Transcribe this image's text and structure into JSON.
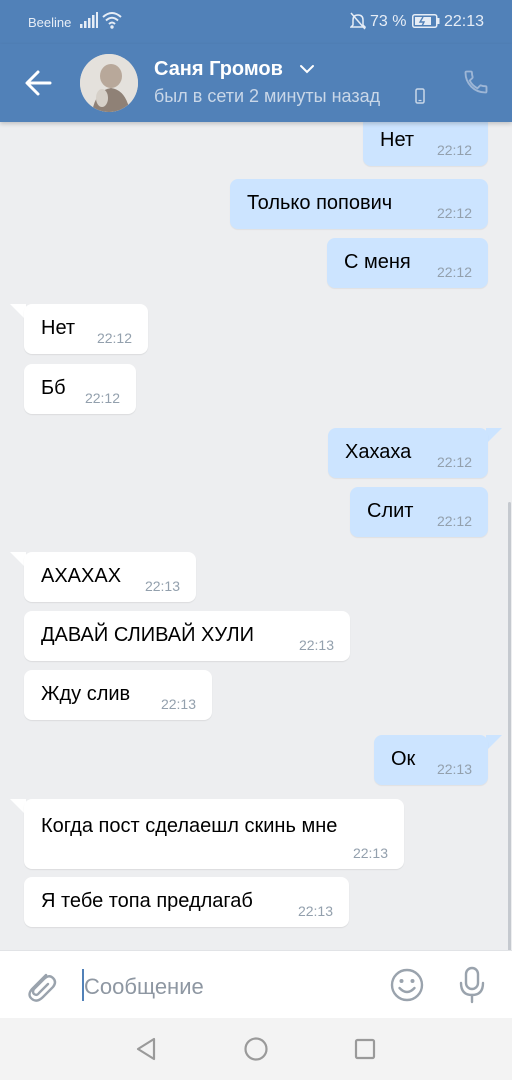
{
  "status_bar": {
    "carrier": "Beeline",
    "battery": "73 %",
    "time": "22:13"
  },
  "header": {
    "contact_name": "Саня Громов",
    "presence": "был в сети 2 минуты назад"
  },
  "messages": [
    {
      "dir": "out",
      "text": "Нет",
      "time": "22:12"
    },
    {
      "dir": "out",
      "text": "Только попович",
      "time": "22:12"
    },
    {
      "dir": "out",
      "text": "С меня",
      "time": "22:12"
    },
    {
      "dir": "in",
      "text": "Нет",
      "time": "22:12"
    },
    {
      "dir": "in",
      "text": "Бб",
      "time": "22:12"
    },
    {
      "dir": "out",
      "text": "Хахаха",
      "time": "22:12"
    },
    {
      "dir": "out",
      "text": "Слит",
      "time": "22:12"
    },
    {
      "dir": "in",
      "text": "АХАХАХ",
      "time": "22:13"
    },
    {
      "dir": "in",
      "text": "ДАВАЙ СЛИВАЙ ХУЛИ",
      "time": "22:13"
    },
    {
      "dir": "in",
      "text": "Жду слив",
      "time": "22:13"
    },
    {
      "dir": "out",
      "text": "Ок",
      "time": "22:13"
    },
    {
      "dir": "in",
      "text": "Когда пост сделаешл скинь мне",
      "time": "22:13"
    },
    {
      "dir": "in",
      "text": "Я тебе топа предлагаб",
      "time": "22:13"
    }
  ],
  "composer": {
    "placeholder": "Сообщение"
  },
  "colors": {
    "header": "#5181b8",
    "outgoing": "#cce4ff",
    "incoming": "#ffffff",
    "background": "#edeef0"
  }
}
